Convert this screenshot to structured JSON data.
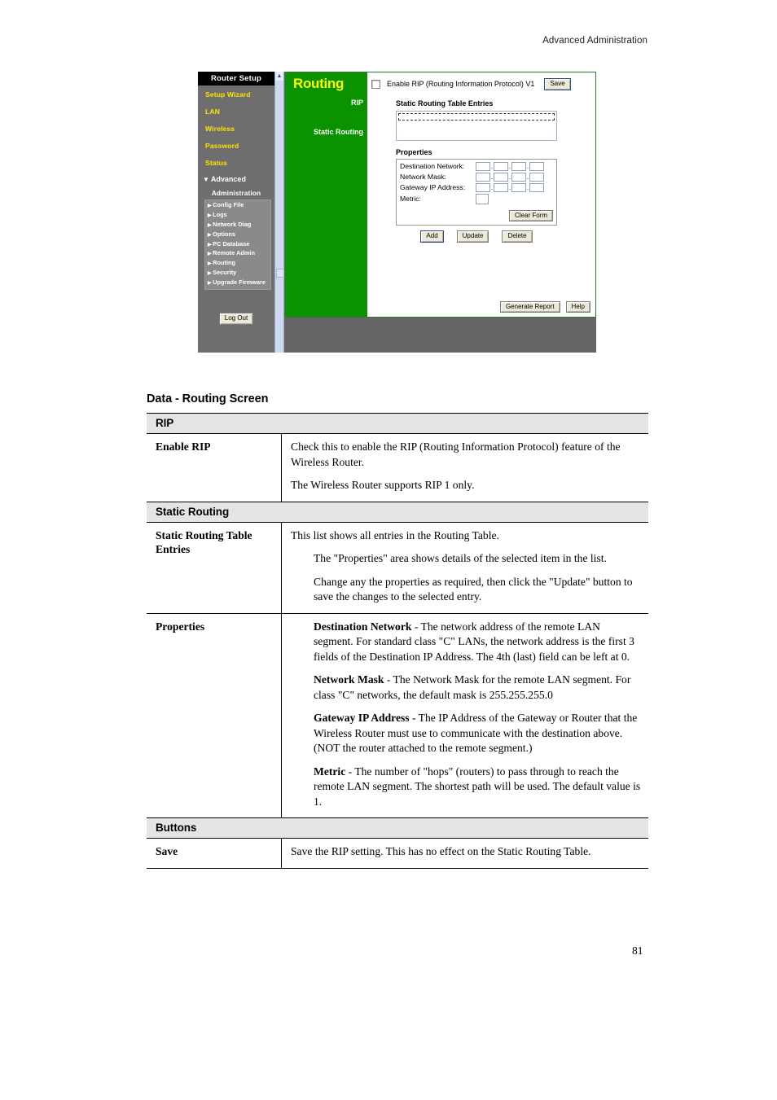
{
  "page": {
    "header": "Advanced Administration",
    "number": "81",
    "section_title": "Data - Routing Screen"
  },
  "screenshot": {
    "nav": {
      "title": "Router Setup",
      "links": [
        "Setup Wizard",
        "LAN",
        "Wireless",
        "Password",
        "Status"
      ],
      "advanced_label": "Advanced",
      "advanced_triangle": "▼",
      "administration_label": "Administration",
      "submenu": [
        "Config File",
        "Logs",
        "Network Diag",
        "Options",
        "PC Database",
        "Remote Admin",
        "Routing",
        "Security",
        "Upgrade Firmware"
      ],
      "submenu_bullet": "▶",
      "logout_label": "Log Out"
    },
    "scrollbar": {
      "up_arrow": "▲"
    },
    "main": {
      "title": "Routing",
      "label_rip": "RIP",
      "label_static_routing": "Static Routing",
      "rip_checkbox_label": "Enable RIP (Routing Information Protocol) V1",
      "rip_checked": false,
      "save_button": "Save",
      "static_table_heading": "Static Routing Table Entries",
      "properties_heading": "Properties",
      "properties_fields": [
        {
          "label": "Destination Network:",
          "octets": 4,
          "values": [
            "",
            "",
            "",
            ""
          ]
        },
        {
          "label": "Network Mask:",
          "octets": 4,
          "values": [
            "",
            "",
            "",
            ""
          ]
        },
        {
          "label": "Gateway IP Address:",
          "octets": 4,
          "values": [
            "",
            "",
            "",
            ""
          ]
        }
      ],
      "metric_label": "Metric:",
      "metric_value": "",
      "clear_form_button": "Clear Form",
      "action_buttons": [
        "Add",
        "Update",
        "Delete"
      ],
      "footer_buttons": [
        "Generate Report",
        "Help"
      ]
    },
    "colors": {
      "green": "#0a9200",
      "title_yellow": "#ffff00",
      "nav_link_yellow": "#ffe400",
      "nav_background": "#6e6e6e",
      "nav_header_black": "#000000",
      "pane_gray": "#666666",
      "scrollbar_blue": "#cdd9ee"
    }
  },
  "table": {
    "sections": [
      {
        "heading": "RIP",
        "rows": [
          {
            "label": "Enable RIP",
            "paragraphs": [
              {
                "text": "Check this to enable the RIP (Routing Information Protocol) feature of the Wireless Router.",
                "indent": false
              },
              {
                "text": "The Wireless Router supports RIP 1 only.",
                "indent": false
              }
            ]
          }
        ]
      },
      {
        "heading": "Static Routing",
        "rows": [
          {
            "label": "Static Routing Table Entries",
            "paragraphs": [
              {
                "text": "This list shows all entries in the Routing Table.",
                "indent": false
              },
              {
                "text": "The \"Properties\" area shows details of the selected item in the list.",
                "indent": true
              },
              {
                "text": "Change any the properties as required, then click the \"Update\" button to save the changes to the selected entry.",
                "indent": true
              }
            ]
          },
          {
            "label": "Properties",
            "paragraphs": [
              {
                "lead": "Destination Network",
                "text": " - The network address of the remote LAN segment. For standard class \"C\" LANs, the network address is the first 3 fields of the Destination IP Address. The 4th (last) field can be left at 0.",
                "indent": true
              },
              {
                "lead": "Network Mask",
                "text": " - The Network Mask for the remote LAN segment. For class \"C\" networks, the default mask is 255.255.255.0",
                "indent": true
              },
              {
                "lead": "Gateway IP Address",
                "text": " - The IP Address of the Gateway or Router that the Wireless Router must use to communicate with the destination above. (NOT the router attached to the remote segment.)",
                "indent": true
              },
              {
                "lead": "Metric",
                "text": " - The number of \"hops\" (routers) to pass through to reach the remote LAN segment. The shortest path will be used. The default value is 1.",
                "indent": true
              }
            ]
          }
        ]
      },
      {
        "heading": "Buttons",
        "rows": [
          {
            "label": "Save",
            "paragraphs": [
              {
                "text": "Save the RIP setting. This has no effect on the Static Routing Table.",
                "indent": false
              }
            ]
          }
        ]
      }
    ]
  }
}
